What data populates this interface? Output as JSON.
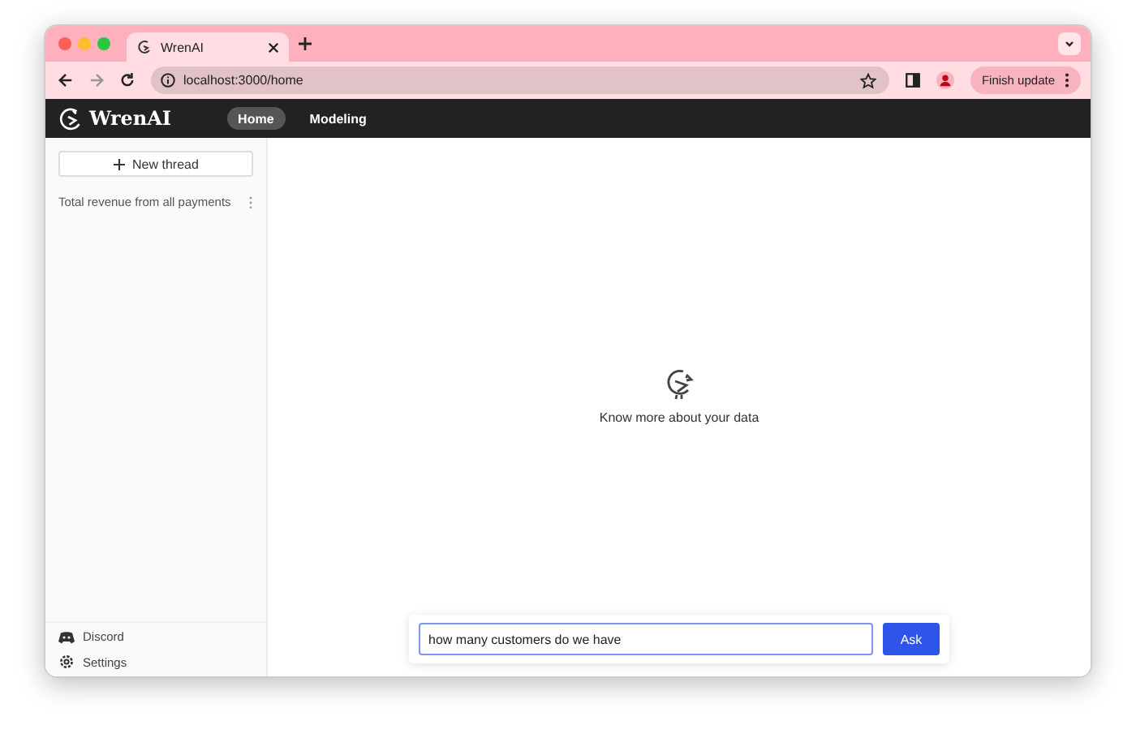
{
  "browser": {
    "tabs": [
      {
        "title": "WrenAI",
        "selected": true
      }
    ],
    "address": "localhost:3000/home",
    "update_button": "Finish update"
  },
  "app": {
    "logo": "WrenAI",
    "nav": [
      {
        "label": "Home",
        "selected": true
      },
      {
        "label": "Modeling",
        "selected": false
      }
    ]
  },
  "sidebar": {
    "new_thread": "New thread",
    "threads": [
      {
        "title": "Total revenue from all payments"
      }
    ],
    "footer": [
      {
        "kind": "discord",
        "label": "Discord"
      },
      {
        "kind": "settings",
        "label": "Settings"
      }
    ]
  },
  "main": {
    "empty_message": "Know more about your data"
  },
  "ask": {
    "value": "how many customers do we have",
    "button": "Ask"
  }
}
